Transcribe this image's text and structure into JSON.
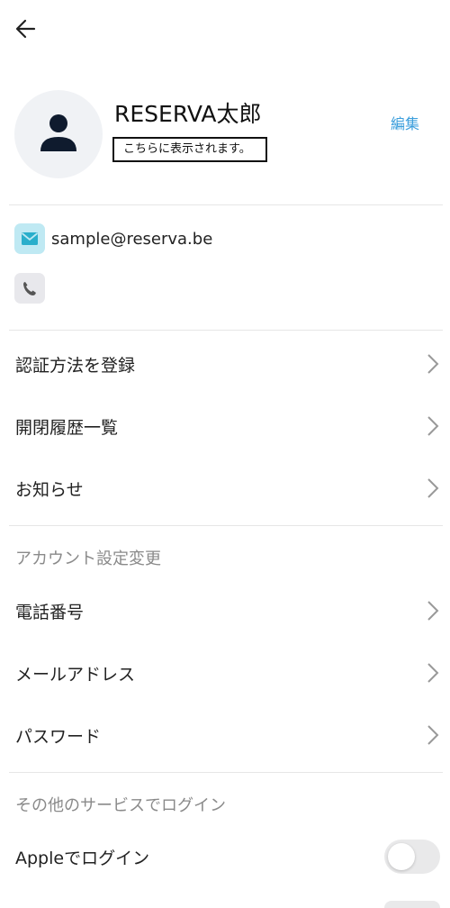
{
  "profile": {
    "name": "RESERVA太郎",
    "subtitle": "こちらに表示されます。",
    "edit_label": "編集",
    "email": "sample@reserva.be",
    "phone": ""
  },
  "menu": {
    "items": [
      {
        "label": "認証方法を登録"
      },
      {
        "label": "開閉履歴一覧"
      },
      {
        "label": "お知らせ"
      }
    ]
  },
  "account_section": {
    "heading": "アカウント設定変更",
    "items": [
      {
        "label": "電話番号"
      },
      {
        "label": "メールアドレス"
      },
      {
        "label": "パスワード"
      }
    ]
  },
  "login_section": {
    "heading": "その他のサービスでログイン",
    "items": [
      {
        "label": "Appleでログイン",
        "enabled": false
      }
    ]
  },
  "colors": {
    "accent": "#3b9edc",
    "email_icon_bg": "#bfe9f3",
    "email_icon_fg": "#29aecb",
    "phone_icon_bg": "#e8e8ec"
  }
}
